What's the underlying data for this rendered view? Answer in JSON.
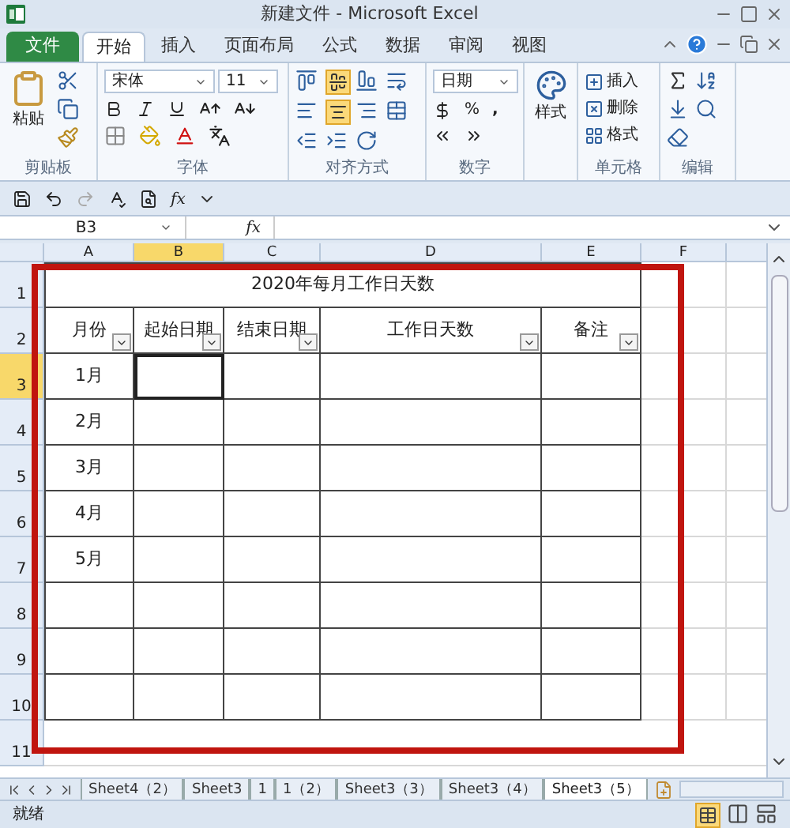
{
  "window": {
    "title": "新建文件 - Microsoft Excel"
  },
  "tabs": [
    {
      "label": "文件",
      "kind": "file",
      "selected": false
    },
    {
      "label": "开始",
      "kind": "tab",
      "selected": true
    },
    {
      "label": "插入",
      "kind": "tab",
      "selected": false
    },
    {
      "label": "页面布局",
      "kind": "tab",
      "selected": false
    },
    {
      "label": "公式",
      "kind": "tab",
      "selected": false
    },
    {
      "label": "数据",
      "kind": "tab",
      "selected": false
    },
    {
      "label": "审阅",
      "kind": "tab",
      "selected": false
    },
    {
      "label": "视图",
      "kind": "tab",
      "selected": false
    }
  ],
  "ribbon": {
    "paste": "粘贴",
    "font_name": "宋体",
    "font_size": "11",
    "number_format": "日期",
    "percent": "%",
    "comma": ",",
    "styles": "样式",
    "insert": "插入",
    "delete": "删除",
    "format": "格式",
    "groups": [
      "剪贴板",
      "字体",
      "对齐方式",
      "数字",
      "单元格",
      "编辑"
    ]
  },
  "quick_access": {
    "insert_function": "fx"
  },
  "formula_bar": {
    "name_box": "B3",
    "function_button": "fx"
  },
  "columns": [
    {
      "label": "A",
      "selected": false
    },
    {
      "label": "B",
      "selected": true
    },
    {
      "label": "C",
      "selected": false
    },
    {
      "label": "D",
      "selected": false
    },
    {
      "label": "E",
      "selected": false
    },
    {
      "label": "F",
      "selected": false
    }
  ],
  "row_numbers": [
    {
      "label": "1",
      "selected": false
    },
    {
      "label": "2",
      "selected": false
    },
    {
      "label": "3",
      "selected": true
    },
    {
      "label": "4",
      "selected": false
    },
    {
      "label": "5",
      "selected": false
    },
    {
      "label": "6",
      "selected": false
    },
    {
      "label": "7",
      "selected": false
    },
    {
      "label": "8",
      "selected": false
    },
    {
      "label": "9",
      "selected": false
    },
    {
      "label": "10",
      "selected": false
    },
    {
      "label": "11",
      "selected": false
    }
  ],
  "table": {
    "title": "2020年每月工作日天数",
    "headers": [
      "月份",
      "起始日期",
      "结束日期",
      "工作日天数",
      "备注"
    ],
    "body_rows": [
      {
        "cells": [
          {
            "text": "1月",
            "selected": false
          },
          {
            "selected": true
          },
          {
            "selected": false
          },
          {
            "selected": false
          },
          {
            "selected": false
          }
        ]
      },
      {
        "cells": [
          {
            "text": "2月",
            "selected": false
          },
          {
            "selected": false
          },
          {
            "selected": false
          },
          {
            "selected": false
          },
          {
            "selected": false
          }
        ]
      },
      {
        "cells": [
          {
            "text": "3月",
            "selected": false
          },
          {
            "selected": false
          },
          {
            "selected": false
          },
          {
            "selected": false
          },
          {
            "selected": false
          }
        ]
      },
      {
        "cells": [
          {
            "text": "4月",
            "selected": false
          },
          {
            "selected": false
          },
          {
            "selected": false
          },
          {
            "selected": false
          },
          {
            "selected": false
          }
        ]
      },
      {
        "cells": [
          {
            "text": "5月",
            "selected": false
          },
          {
            "selected": false
          },
          {
            "selected": false
          },
          {
            "selected": false
          },
          {
            "selected": false
          }
        ]
      },
      {
        "cells": [
          {
            "selected": false
          },
          {
            "selected": false
          },
          {
            "selected": false
          },
          {
            "selected": false
          },
          {
            "selected": false
          }
        ]
      },
      {
        "cells": [
          {
            "selected": false
          },
          {
            "selected": false
          },
          {
            "selected": false
          },
          {
            "selected": false
          },
          {
            "selected": false
          }
        ]
      },
      {
        "cells": [
          {
            "selected": false
          },
          {
            "selected": false
          },
          {
            "selected": false
          },
          {
            "selected": false
          },
          {
            "selected": false
          }
        ]
      }
    ]
  },
  "sheet_tabs": [
    {
      "label": "Sheet4（2）",
      "selected": false
    },
    {
      "label": "Sheet3",
      "selected": false
    },
    {
      "label": "1",
      "selected": false
    },
    {
      "label": "1（2）",
      "selected": false
    },
    {
      "label": "Sheet3（3）",
      "selected": false
    },
    {
      "label": "Sheet3（4）",
      "selected": false
    },
    {
      "label": "Sheet3（5）",
      "selected": true
    }
  ],
  "status_bar": {
    "text": "就绪"
  }
}
